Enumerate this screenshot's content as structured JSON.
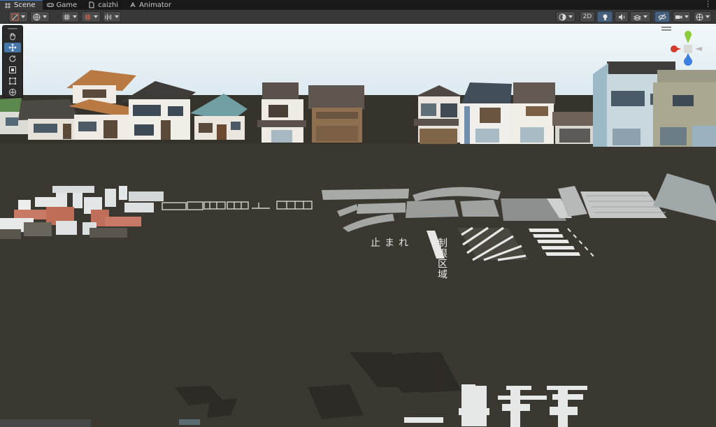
{
  "tabs": [
    {
      "label": "Scene",
      "icon": "scene-grid-icon",
      "active": true
    },
    {
      "label": "Game",
      "icon": "gamepad-icon",
      "active": false
    },
    {
      "label": "caizhi",
      "icon": "document-icon",
      "active": false
    },
    {
      "label": "Animator",
      "icon": "animator-icon",
      "active": false
    }
  ],
  "tab_menu_icon": "more-vertical-icon",
  "toolbar": {
    "left": [
      {
        "icon": "tool-handle-position-icon",
        "dropdown": true
      },
      {
        "icon": "global-local-icon",
        "dropdown": true
      },
      {
        "icon": "grid-snap-icon",
        "dropdown": true
      },
      {
        "icon": "increment-snap-icon",
        "dropdown": true
      },
      {
        "icon": "audio-effects-icon",
        "dropdown": true
      }
    ],
    "right": [
      {
        "icon": "shading-mode-icon",
        "dropdown": true
      },
      {
        "label": "2D"
      },
      {
        "icon": "lighting-icon",
        "active": true
      },
      {
        "icon": "audio-icon"
      },
      {
        "icon": "effects-icon",
        "dropdown": true
      },
      {
        "icon": "hidden-objects-icon",
        "active": true
      },
      {
        "icon": "camera-icon",
        "dropdown": true
      },
      {
        "icon": "gizmos-icon",
        "dropdown": true
      }
    ]
  },
  "tools": [
    "hand-tool-icon",
    "move-tool-icon",
    "rotate-tool-icon",
    "scale-tool-icon",
    "rect-tool-icon",
    "transform-tool-icon"
  ],
  "selected_tool": "move-tool-icon",
  "scene": {
    "sign_text": "制限区域",
    "road_marking_text": "止まれ"
  },
  "colors": {
    "sky": "#e9f2f6",
    "ground": "#3b3731",
    "gizmo_x": "#d63b2c",
    "gizmo_y": "#8bcc3a",
    "gizmo_z": "#3c7ee0",
    "selection": "#4777a8"
  }
}
